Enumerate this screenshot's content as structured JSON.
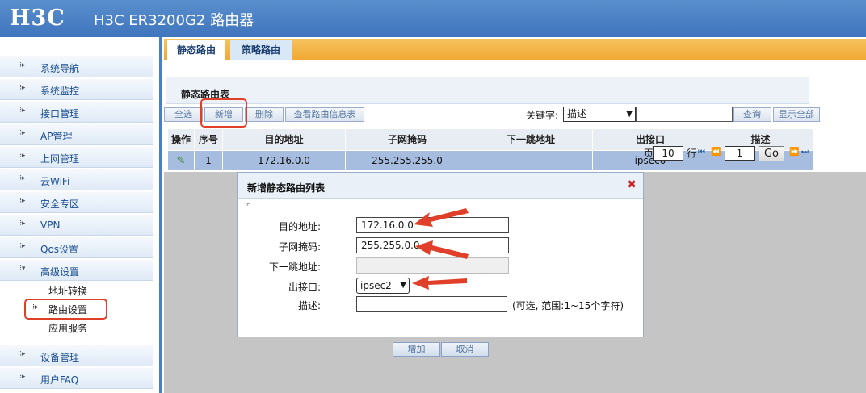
{
  "header": {
    "logo": "H3C",
    "product": "H3C ER3200G2 路由器"
  },
  "sidebar": {
    "items": [
      {
        "label": "系统导航",
        "icon": "expand-icon"
      },
      {
        "label": "系统监控",
        "icon": "expand-icon"
      },
      {
        "label": "接口管理",
        "icon": "expand-icon"
      },
      {
        "label": "AP管理",
        "icon": "expand-icon"
      },
      {
        "label": "上网管理",
        "icon": "expand-icon"
      },
      {
        "label": "云WiFi",
        "icon": "expand-icon"
      },
      {
        "label": "安全专区",
        "icon": "expand-icon"
      },
      {
        "label": "VPN",
        "icon": "expand-icon"
      },
      {
        "label": "Qos设置",
        "icon": "expand-icon"
      },
      {
        "label": "高级设置",
        "icon": "collapse-icon"
      },
      {
        "label": "设备管理",
        "icon": "expand-icon"
      },
      {
        "label": "用户FAQ",
        "icon": "expand-icon"
      }
    ],
    "subitems": [
      "地址转换",
      "路由设置",
      "应用服务"
    ]
  },
  "tabs": {
    "static": "静态路由",
    "policy": "策略路由"
  },
  "panel": {
    "title": "静态路由表"
  },
  "toolbar": {
    "select_all": "全选",
    "add": "新增",
    "delete": "删除",
    "view_info": "查看路由信息表",
    "keyword_label": "关键字:",
    "keyword_select": "描述",
    "query": "查询",
    "show_all": "显示全部"
  },
  "table": {
    "headers": [
      "操作",
      "序号",
      "目的地址",
      "子网掩码",
      "下一跳地址",
      "出接口",
      "描述"
    ],
    "rows": [
      {
        "index": "1",
        "dest": "172.16.0.0",
        "mask": "255.255.255.0",
        "next_hop": "",
        "iface": "ipsec0",
        "desc": ""
      }
    ]
  },
  "pager": {
    "per_page_suffix": "页",
    "per_page": "10",
    "rows_label": "行",
    "page": "1",
    "go": "Go"
  },
  "dialog": {
    "title": "新增静态路由列表",
    "dest_label": "目的地址:",
    "dest_value": "172.16.0.0",
    "mask_label": "子网掩码:",
    "mask_value": "255.255.0.0",
    "nexthop_label": "下一跳地址:",
    "nexthop_value": "",
    "iface_label": "出接口:",
    "iface_value": "ipsec2",
    "desc_label": "描述:",
    "desc_value": "",
    "desc_hint": "(可选, 范围:1~15个字符)",
    "add_button": "增加",
    "cancel_button": "取消"
  },
  "colors": {
    "header": "#4a80c6",
    "tabbar": "#f0a935",
    "selected_row": "#a7bddf",
    "annotation": "#e0402a"
  }
}
